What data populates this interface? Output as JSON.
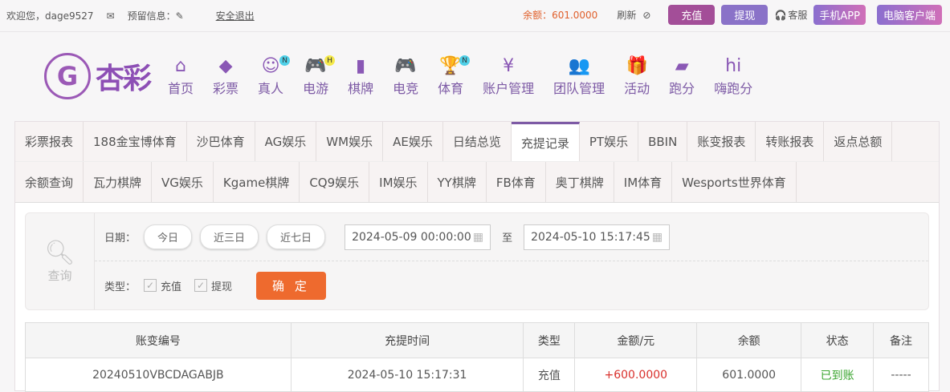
{
  "topbar": {
    "welcome": "欢迎您，dage9527",
    "reserved": "预留信息：",
    "logout": "安全退出",
    "balance": "余额：601.0000",
    "refresh": "刷新",
    "deposit": "充值",
    "withdraw": "提现",
    "service": "客服",
    "mobile_app": "手机APP",
    "pc_client": "电脑客户端"
  },
  "logo": {
    "text": "杏彩"
  },
  "nav": [
    {
      "label": "首页",
      "icon": "home-icon",
      "glyph": "⌂"
    },
    {
      "label": "彩票",
      "icon": "ticket-icon",
      "glyph": "◆"
    },
    {
      "label": "真人",
      "icon": "woman-icon",
      "glyph": "☺",
      "badge": "N"
    },
    {
      "label": "电游",
      "icon": "gamepad-icon",
      "glyph": "🎮",
      "badge": "H"
    },
    {
      "label": "棋牌",
      "icon": "cards-icon",
      "glyph": "▮"
    },
    {
      "label": "电竞",
      "icon": "gamepad-icon",
      "glyph": "🎮"
    },
    {
      "label": "体育",
      "icon": "trophy-icon",
      "glyph": "🏆",
      "badge": "N"
    },
    {
      "label": "账户管理",
      "icon": "yen-icon",
      "glyph": "¥"
    },
    {
      "label": "团队管理",
      "icon": "team-icon",
      "glyph": "👥"
    },
    {
      "label": "活动",
      "icon": "gift-icon",
      "glyph": "🎁"
    },
    {
      "label": "跑分",
      "icon": "rhino-icon",
      "glyph": "▰"
    },
    {
      "label": "嗨跑分",
      "icon": "hi-icon",
      "glyph": "hi"
    }
  ],
  "tabs_row1": [
    "彩票报表",
    "188金宝博体育",
    "沙巴体育",
    "AG娱乐",
    "WM娱乐",
    "AE娱乐",
    "日结总览",
    "充提记录",
    "PT娱乐",
    "BBIN",
    "账变报表",
    "转账报表",
    "返点总额"
  ],
  "tabs_row2": [
    "余额查询",
    "瓦力棋牌",
    "VG娱乐",
    "Kgame棋牌",
    "CQ9娱乐",
    "IM娱乐",
    "YY棋牌",
    "FB体育",
    "奥丁棋牌",
    "IM体育",
    "Wesports世界体育"
  ],
  "active_tab": "充提记录",
  "filter": {
    "query": "查询",
    "date_label": "日期：",
    "today": "今日",
    "three_days": "近三日",
    "seven_days": "近七日",
    "start": "2024-05-09 00:00:00",
    "to": "至",
    "end": "2024-05-10 15:17:45",
    "type_label": "类型：",
    "deposit": "充值",
    "withdraw": "提现",
    "confirm": "确 定"
  },
  "table": {
    "headers": [
      "账变编号",
      "充提时间",
      "类型",
      "金额/元",
      "余额",
      "状态",
      "备注"
    ],
    "rows": [
      [
        "20240510VBCDAGABJB",
        "2024-05-10 15:17:31",
        "充值",
        "+600.0000",
        "601.0000",
        "已到账",
        "-----"
      ]
    ]
  },
  "colors": {
    "accent": "#7d5aa5",
    "confirm": "#ee6a2e",
    "amount": "#d9302c",
    "status": "#3aa52f"
  }
}
